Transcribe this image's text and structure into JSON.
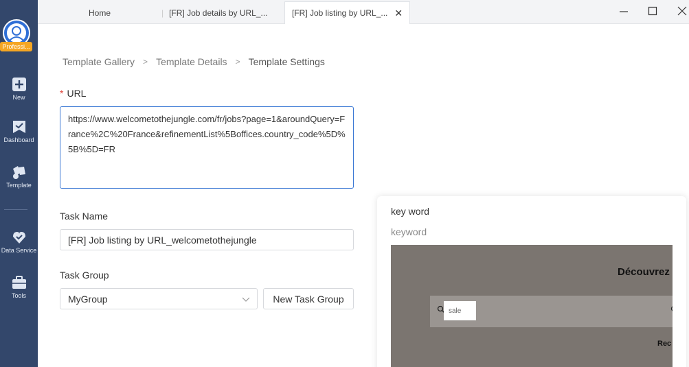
{
  "sidebar": {
    "plan_badge": "Professi...",
    "items": [
      {
        "icon": "plus-square-icon",
        "label": "New"
      },
      {
        "icon": "dashboard-icon",
        "label": "Dashboard"
      },
      {
        "icon": "template-icon",
        "label": "Template"
      },
      {
        "icon": "data-service-icon",
        "label": "Data Service"
      },
      {
        "icon": "toolbox-icon",
        "label": "Tools"
      }
    ]
  },
  "tabs": [
    {
      "label": "Home"
    },
    {
      "label": "[FR] Job details by URL_..."
    },
    {
      "label": "[FR] Job listing by URL_..."
    }
  ],
  "window_controls": {
    "minimize": "minimize-icon",
    "maximize": "maximize-icon",
    "close": "close-icon"
  },
  "breadcrumb": [
    "Template Gallery",
    "Template Details",
    "Template Settings"
  ],
  "form": {
    "url_label": "URL",
    "url_required_mark": "*",
    "url_value": "https://www.welcometothejungle.com/fr/jobs?page=1&aroundQuery=France%2C%20France&refinementList%5Boffices.country_code%5D%5B%5D=FR",
    "task_name_label": "Task Name",
    "task_name_value": "[FR] Job listing by URL_welcometothejungle",
    "task_group_label": "Task Group",
    "task_group_value": "MyGroup",
    "new_task_group_button": "New Task Group"
  },
  "panel": {
    "title": "key word",
    "subtitle": "keyword",
    "preview": {
      "heading": "Découvrez",
      "search_value": "sale",
      "bottom_text": "Rec"
    }
  },
  "colors": {
    "sidebar_bg": "#33476b",
    "accent_blue": "#3a78d4",
    "badge_orange": "#f5a623",
    "required_red": "#e0443a"
  }
}
